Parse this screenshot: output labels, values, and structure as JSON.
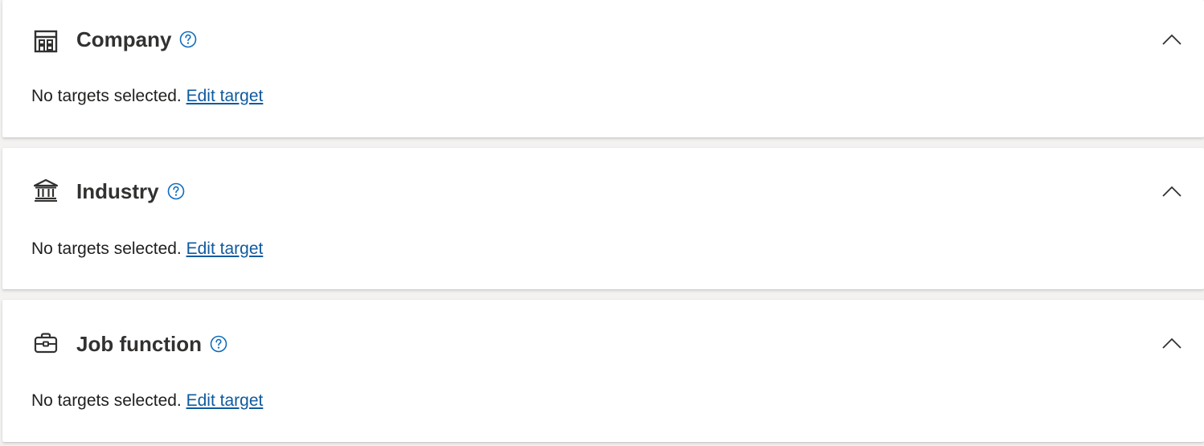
{
  "sections": [
    {
      "title": "Company",
      "icon": "building-icon",
      "status_text": "No targets selected.",
      "edit_link": "Edit target",
      "expanded": true
    },
    {
      "title": "Industry",
      "icon": "bank-icon",
      "status_text": "No targets selected.",
      "edit_link": "Edit target",
      "expanded": true
    },
    {
      "title": "Job function",
      "icon": "briefcase-icon",
      "status_text": "No targets selected.",
      "edit_link": "Edit target",
      "expanded": true
    }
  ],
  "colors": {
    "link": "#0f5a9e",
    "help_icon": "#0f6cbd",
    "title": "#323130",
    "background": "#f3f2f1",
    "card": "#ffffff"
  }
}
